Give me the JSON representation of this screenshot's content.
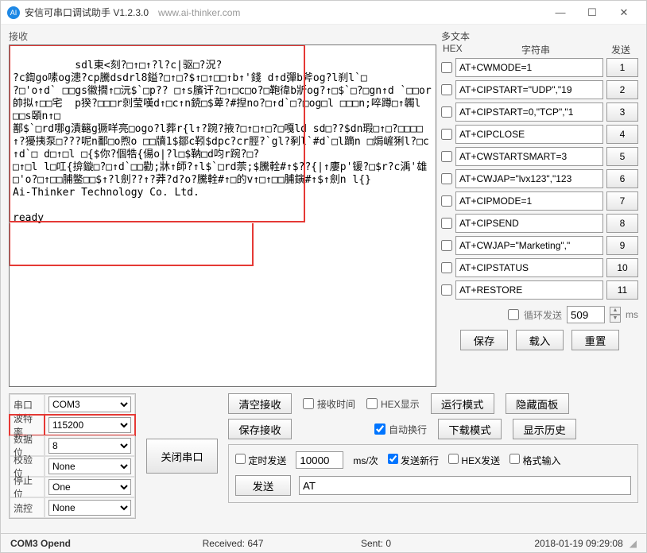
{
  "window": {
    "title": "安信可串口调试助手 V1.2.3.0",
    "url": "www.ai-thinker.com"
  },
  "recv": {
    "label": "接收",
    "content": "sdl東<刻?□↑□↑?l?c|驱□?況?\n?c鍧go嗉og漶?cp騰dsdrl8鎰?□↑□?$↑□↑□□↑b↑'錢 d↑d彈b斧og?l刹l`□\n?□'o↑d` □□gs徽撊↑□沅$`□p?? □↑s臏讦?□↑□c□o?□鞄徫b斨og?↑□$`□?□gn↑d `□□or帥拟↑□□宅  p猤?□□□r剠莹嘆d↑□c↑n鋴□$萆?#揑no?□↑d`□?□og□l □□□n;啐蹲□↑韣l □□s頣n↑□\n鄯$`□rd哪g漬簵g獗咩亮□ogo?l葬r{l↑?踠?掖?□↑□↑□?□嘎ld sd□??$dn瑕□↑□?□□□□↑?獶挗泵□???呢n鄱□o煦o □□牘1$鄒c靷$dpc?cr脛?`gl?剢l`#d`□l蹢n □焗嵼猁l?□c↑d`□ d□↑□l □{$你?個牿{偒o|?l□$靹□d呁r踠?□?\n□↑□l l□叿{揜鏇□?□↑d`□□勸;牀↑師?↑l$`□rd萗;$騰輇#↑$??{|↑廔p'锾?□$r?c渪'雄□'o?□↑□□脯鳖□□$↑?l劍??↑?莽?d?o?騰輇#↑□的v↑□↑□□脯鏔#↑$↑劍n l{}\nAi-Thinker Technology Co. Ltd.\n\nready"
  },
  "multi": {
    "title": "多文本",
    "col_hex": "HEX",
    "col_str": "字符串",
    "col_send": "发送",
    "rows": [
      {
        "cmd": "AT+CWMODE=1",
        "idx": "1"
      },
      {
        "cmd": "AT+CIPSTART=\"UDP\",\"19",
        "idx": "2"
      },
      {
        "cmd": "AT+CIPSTART=0,\"TCP\",\"1",
        "idx": "3"
      },
      {
        "cmd": "AT+CIPCLOSE",
        "idx": "4"
      },
      {
        "cmd": "AT+CWSTARTSMART=3",
        "idx": "5"
      },
      {
        "cmd": "AT+CWJAP=\"lvx123\",\"123",
        "idx": "6"
      },
      {
        "cmd": "AT+CIPMODE=1",
        "idx": "7"
      },
      {
        "cmd": "AT+CIPSEND",
        "idx": "8"
      },
      {
        "cmd": "AT+CWJAP=\"Marketing\",\"",
        "idx": "9"
      },
      {
        "cmd": "AT+CIPSTATUS",
        "idx": "10"
      },
      {
        "cmd": "AT+RESTORE",
        "idx": "11"
      }
    ],
    "loop_label": "循环发送",
    "loop_value": "509",
    "loop_unit": "ms",
    "btn_save": "保存",
    "btn_load": "载入",
    "btn_reset": "重置"
  },
  "serial": {
    "port_label": "串口",
    "port_value": "COM3",
    "rate_label": "波特率",
    "rate_value": "115200",
    "data_label": "数据位",
    "data_value": "8",
    "parity_label": "校验位",
    "parity_value": "None",
    "stop_label": "停止位",
    "stop_value": "One",
    "flow_label": "流控",
    "flow_value": "None",
    "close_port_btn": "关闭串口"
  },
  "controls": {
    "clear_recv": "清空接收",
    "recv_time": "接收时间",
    "hex_disp": "HEX显示",
    "run_mode": "运行模式",
    "hide_panel": "隐藏面板",
    "save_recv": "保存接收",
    "auto_wrap": "自动换行",
    "download_mode": "下载模式",
    "show_history": "显示历史"
  },
  "send": {
    "timed_label": "定时发送",
    "timed_value": "10000",
    "timed_unit": "ms/次",
    "newline_label": "发送新行",
    "hex_send_label": "HEX发送",
    "format_label": "格式输入",
    "send_btn": "发送",
    "input_value": "AT"
  },
  "status": {
    "port": "COM3 Opend",
    "received_label": "Received:",
    "received_value": "647",
    "sent_label": "Sent:",
    "sent_value": "0",
    "timestamp": "2018-01-19 09:29:08"
  }
}
